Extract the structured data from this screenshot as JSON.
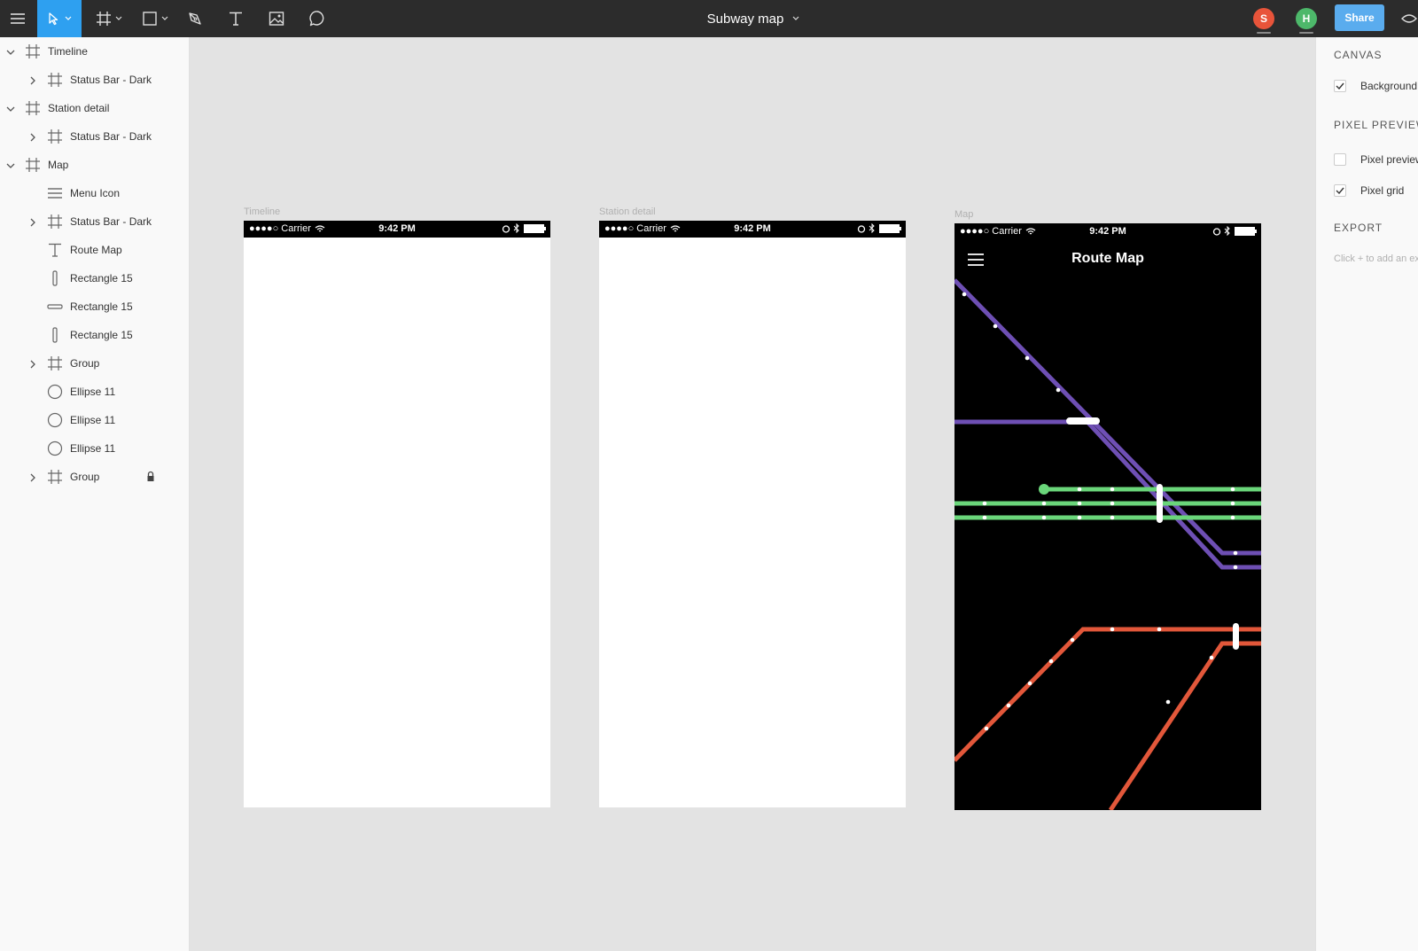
{
  "toolbar": {
    "doc_title": "Subway map",
    "share_label": "Share",
    "avatars": [
      {
        "initial": "S",
        "color": "#e8543a"
      },
      {
        "initial": "H",
        "color": "#4db86a"
      }
    ],
    "accent": "#2ea0f0"
  },
  "layers": [
    {
      "name": "Timeline",
      "icon": "frame-icon",
      "expand": "expanded",
      "indent": 0
    },
    {
      "name": "Status Bar - Dark",
      "icon": "frame-icon",
      "expand": "collapsed",
      "indent": 1
    },
    {
      "name": "Station detail",
      "icon": "frame-icon",
      "expand": "expanded",
      "indent": 0
    },
    {
      "name": "Status Bar - Dark",
      "icon": "frame-icon",
      "expand": "collapsed",
      "indent": 1
    },
    {
      "name": "Map",
      "icon": "frame-icon",
      "expand": "expanded",
      "indent": 0
    },
    {
      "name": "Menu Icon",
      "icon": "menu-lines-icon",
      "expand": "none",
      "indent": 1
    },
    {
      "name": "Status Bar - Dark",
      "icon": "frame-icon",
      "expand": "collapsed",
      "indent": 1
    },
    {
      "name": "Route Map",
      "icon": "text-icon",
      "expand": "none",
      "indent": 1
    },
    {
      "name": "Rectangle 15",
      "icon": "rect-vertical-icon",
      "expand": "none",
      "indent": 1
    },
    {
      "name": "Rectangle 15",
      "icon": "rect-horizontal-icon",
      "expand": "none",
      "indent": 1
    },
    {
      "name": "Rectangle 15",
      "icon": "rect-vertical-icon",
      "expand": "none",
      "indent": 1
    },
    {
      "name": "Group",
      "icon": "frame-icon",
      "expand": "collapsed",
      "indent": 1
    },
    {
      "name": "Ellipse 11",
      "icon": "ellipse-icon",
      "expand": "none",
      "indent": 1
    },
    {
      "name": "Ellipse 11",
      "icon": "ellipse-icon",
      "expand": "none",
      "indent": 1
    },
    {
      "name": "Ellipse 11",
      "icon": "ellipse-icon",
      "expand": "none",
      "indent": 1
    },
    {
      "name": "Group",
      "icon": "frame-icon",
      "expand": "collapsed",
      "indent": 1,
      "locked": true
    }
  ],
  "frames": {
    "timeline": {
      "label": "Timeline",
      "status": {
        "carrier": "●●●●○ Carrier",
        "time": "9:42 PM"
      }
    },
    "station_detail": {
      "label": "Station detail",
      "status": {
        "carrier": "●●●●○ Carrier",
        "time": "9:42 PM"
      }
    },
    "map": {
      "label": "Map",
      "status": {
        "carrier": "●●●●○ Carrier",
        "time": "9:42 PM"
      },
      "title": "Route Map",
      "line_colors": {
        "purple": "#6e4fb4",
        "green": "#6ad67a",
        "orange": "#e2573a"
      }
    }
  },
  "properties": {
    "canvas": {
      "heading": "CANVAS",
      "background_label": "Background",
      "background_checked": true
    },
    "pixel_preview": {
      "heading": "PIXEL PREVIEW",
      "preview_label": "Pixel preview",
      "preview_checked": false,
      "grid_label": "Pixel grid",
      "grid_checked": true
    },
    "export": {
      "heading": "EXPORT",
      "hint": "Click + to add an export setting"
    }
  }
}
